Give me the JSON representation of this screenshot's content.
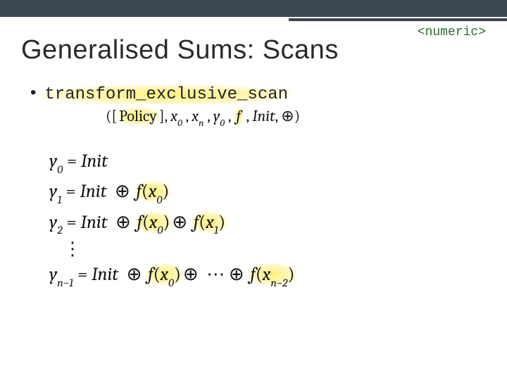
{
  "header": {
    "tag": "<numeric>",
    "title": "Generalised Sums: Scans"
  },
  "func": {
    "name": "transform_exclusive_scan",
    "args_prefix": "([",
    "args_policy": "Policy",
    "args_mid1": "], ",
    "x0": "x",
    "x0_sub": "0",
    "sep": " , ",
    "xn": "x",
    "xn_sub": "n",
    "y0": "y",
    "y0_sub": "0",
    "f": "f",
    "init": "Init",
    "oplus": "⊕",
    "close": ")"
  },
  "eq": {
    "y": "y",
    "eq": " = ",
    "init": "Init",
    "oplus": "⊕",
    "f": "f",
    "x": "x",
    "dots": "⋯",
    "vdots": "⋮",
    "sub0": "0",
    "sub1": "1",
    "sub2": "2",
    "sub_nm1": "n−1",
    "sub_nm2": "n−2"
  }
}
